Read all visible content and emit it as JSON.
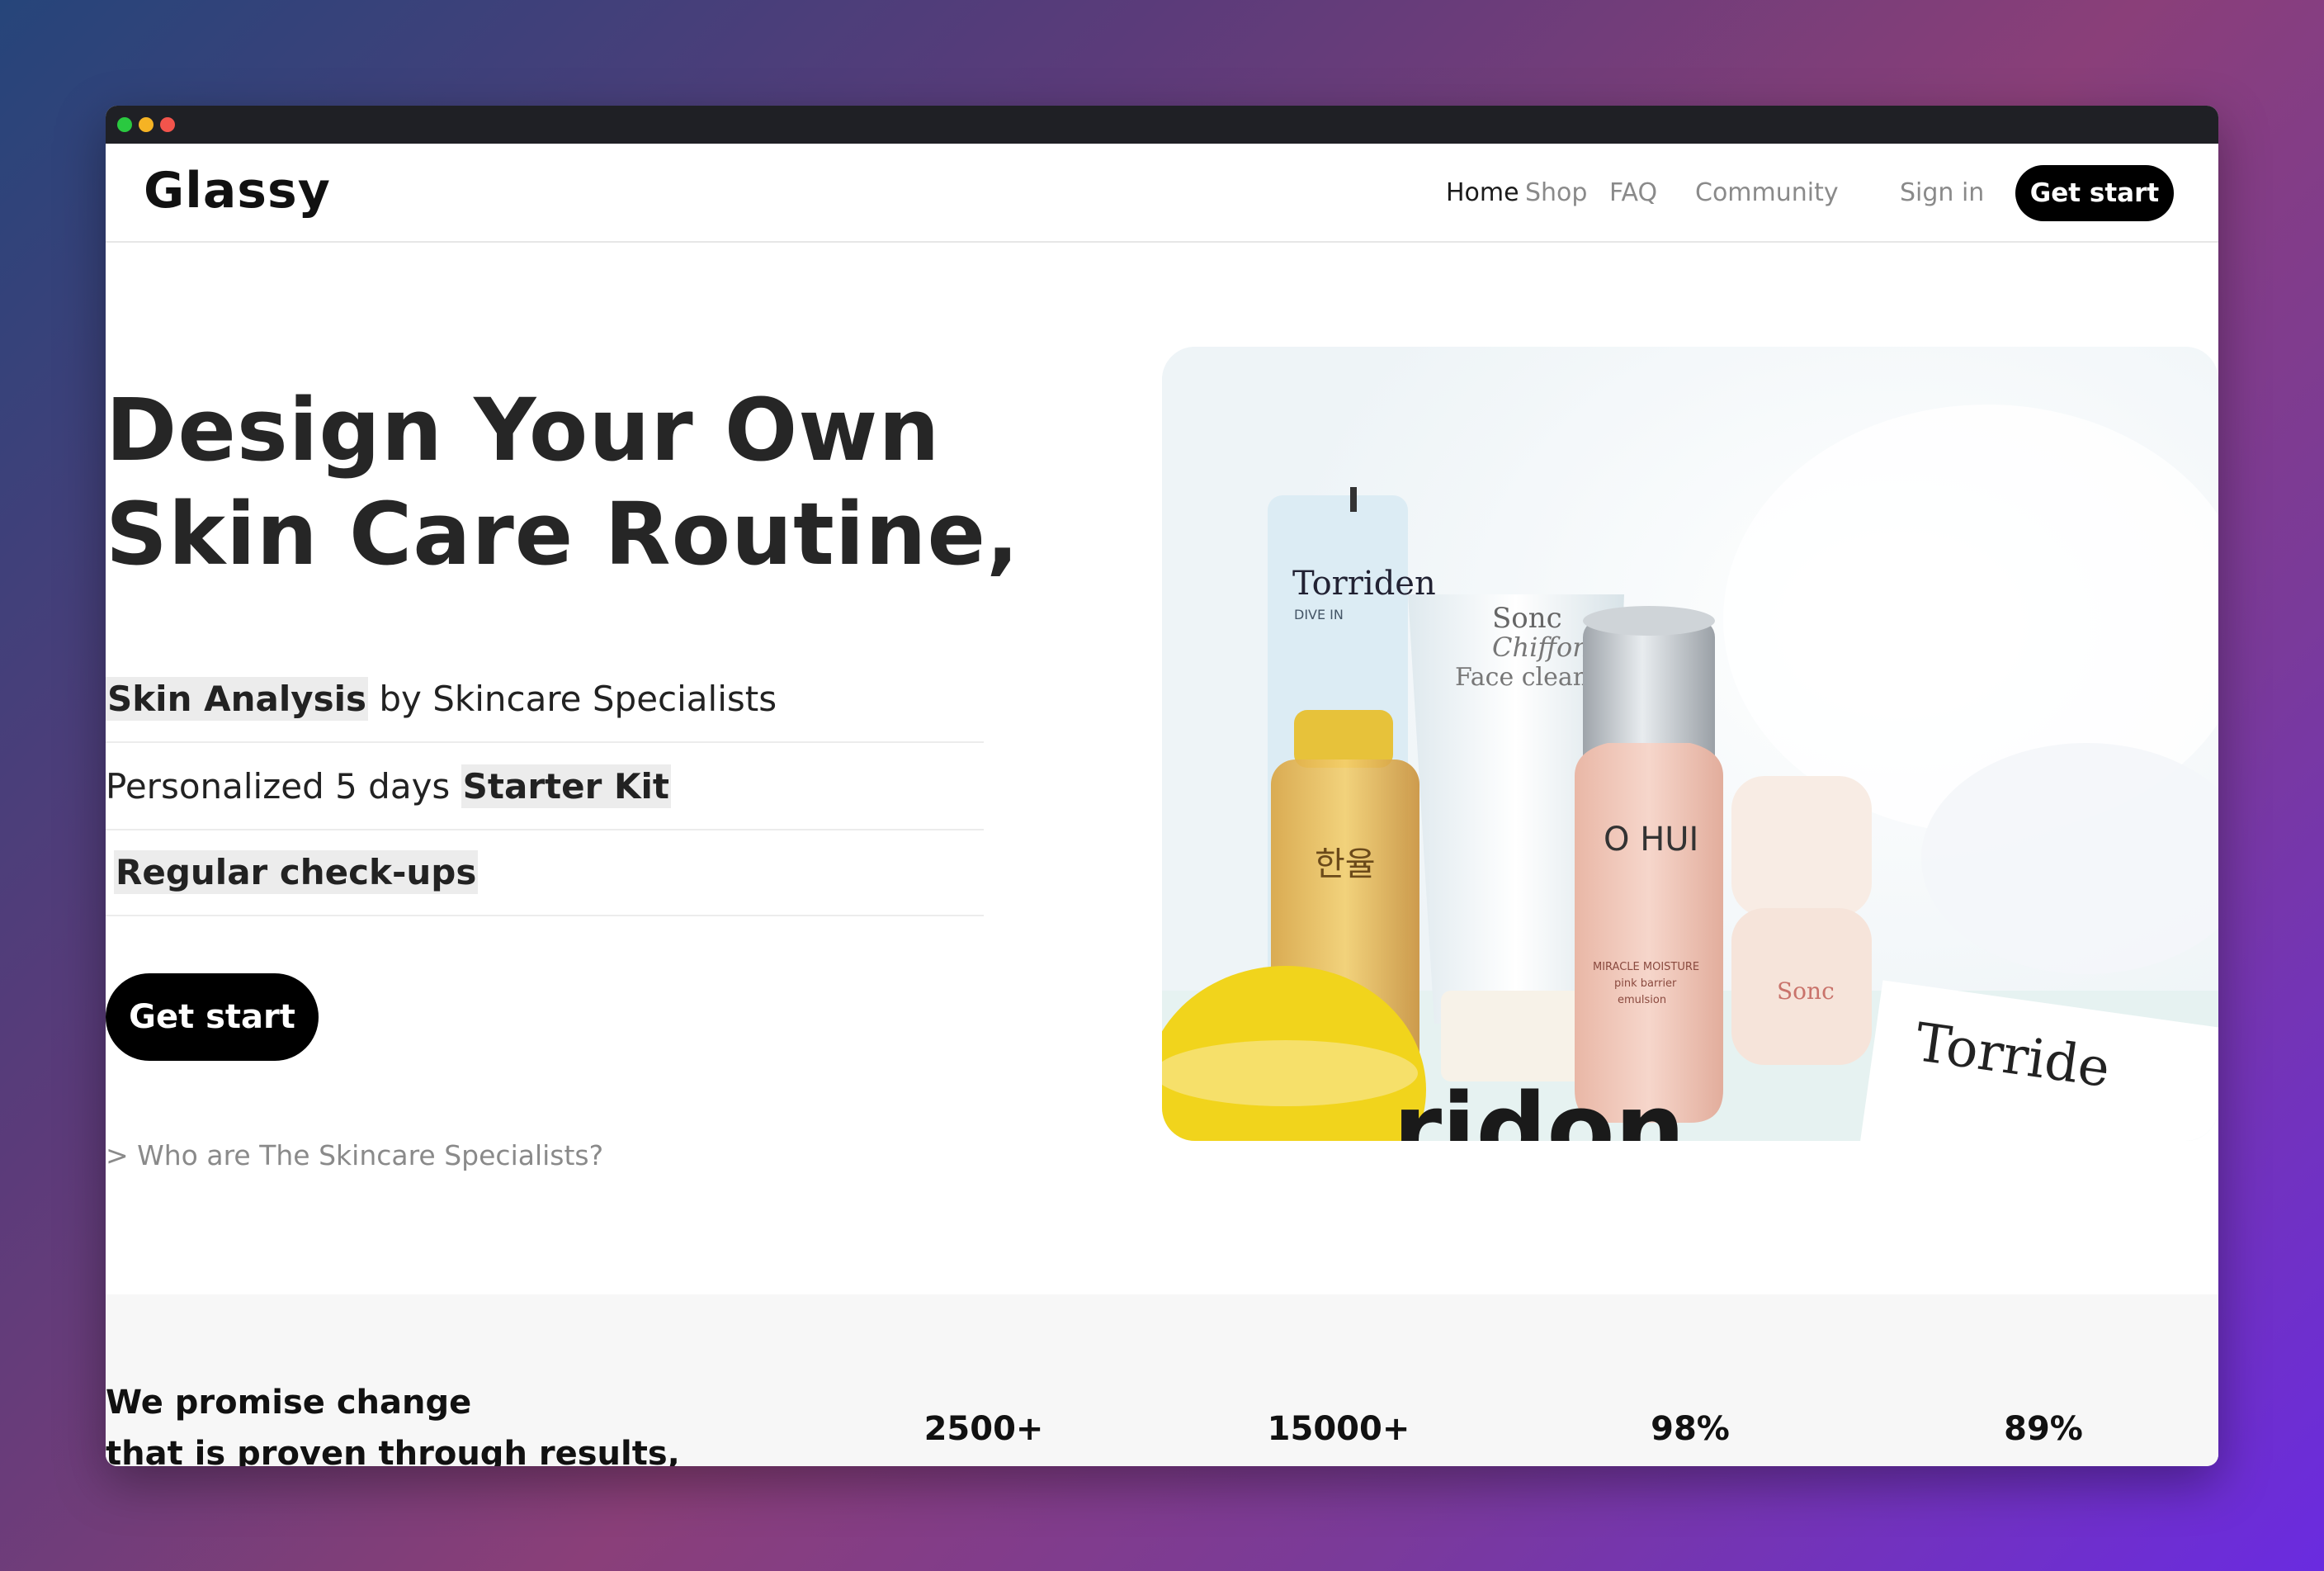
{
  "nav": {
    "logo": "Glassy",
    "links": [
      "Home",
      "Shop",
      "FAQ",
      "Community"
    ],
    "sign_in": "Sign in",
    "cta": "Get start"
  },
  "hero": {
    "title_line1": "Design Your Own",
    "title_line2": "Skin Care Routine,",
    "features": [
      {
        "before": "",
        "highlight": "Skin Analysis",
        "after": " by Skincare Specialists"
      },
      {
        "before": "Personalized 5 days ",
        "highlight": "Starter Kit",
        "after": ""
      },
      {
        "before": "",
        "highlight": "Regular check-ups",
        "after": ""
      }
    ],
    "cta": "Get start",
    "specialist_link": "> Who are The Skincare Specialists?"
  },
  "image": {
    "labels": {
      "tube_brand": "Torriden",
      "tube_sub": "DIVE IN",
      "cleanser_brand": "Sonc",
      "cleanser_line2": "Chiffon",
      "cleanser_line3": "Face cleanser",
      "korean_text": "한율",
      "bottle_brand": "O HUI",
      "bottle_sub1": "MIRACLE MOISTURE",
      "bottle_sub2": "pink barrier",
      "bottle_sub3": "emulsion",
      "jar_brand": "Sonc",
      "card_text": "Torride",
      "bottom_text": "ridon"
    }
  },
  "stats": {
    "promise_line1": "We promise change",
    "promise_line2": "that is proven through results,",
    "values": [
      "2500+",
      "15000+",
      "98%",
      "89%"
    ]
  },
  "colors": {
    "window_titlebar": "#1f2025",
    "button_bg": "#000000",
    "highlight_bg": "#ececec",
    "stats_band_bg": "#f7f7f7"
  }
}
